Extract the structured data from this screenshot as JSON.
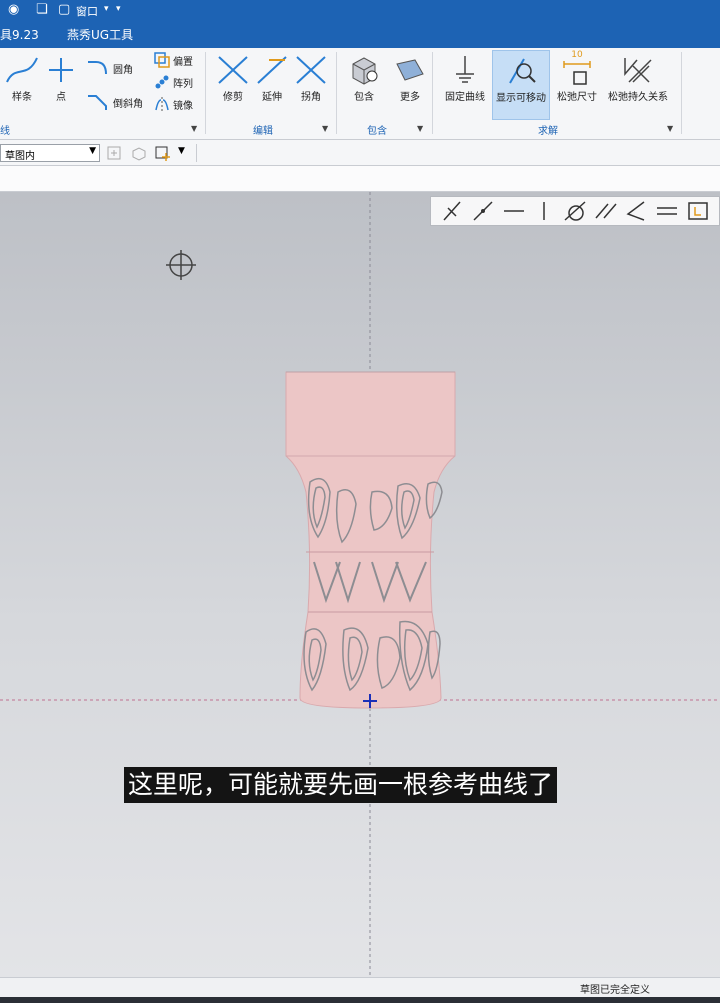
{
  "titlebar": {
    "window_menu_label": "窗口",
    "dropdown_glyph": "▾"
  },
  "tabs": [
    {
      "label": "具9.23"
    },
    {
      "label": "燕秀UG工具"
    }
  ],
  "ribbon": {
    "curve_group": {
      "label": "线",
      "spline_label": "样条",
      "point_label": "点",
      "fillet_label": "圆角",
      "chamfer_label": "倒斜角",
      "offset_label": "偏置",
      "pattern_label": "阵列",
      "mirror_label": "镜像"
    },
    "edit_group": {
      "label": "编辑",
      "trim_label": "修剪",
      "extend_label": "延伸",
      "corner_label": "拐角"
    },
    "include_group": {
      "label": "包含",
      "include_label": "包含",
      "more_label": "更多"
    },
    "solve_group": {
      "label": "求解",
      "fix_curve_label": "固定曲线",
      "show_movable_label": "显示可移动",
      "relax_dimension_label": "松弛尺寸",
      "relax_dimension_value": "10",
      "relax_persistent_label": "松弛持久关系"
    }
  },
  "toolrow": {
    "select_value": "草图内"
  },
  "subtitle": {
    "text": "这里呢，可能就要先画一根参考曲线了"
  },
  "statusbar": {
    "text": "草图已完全定义"
  },
  "colors": {
    "brand_blue": "#1d63b4",
    "model_pink": "#ecc6c6",
    "engrave_gray": "#8d8d92",
    "axis_blue": "#1a2fb8"
  }
}
